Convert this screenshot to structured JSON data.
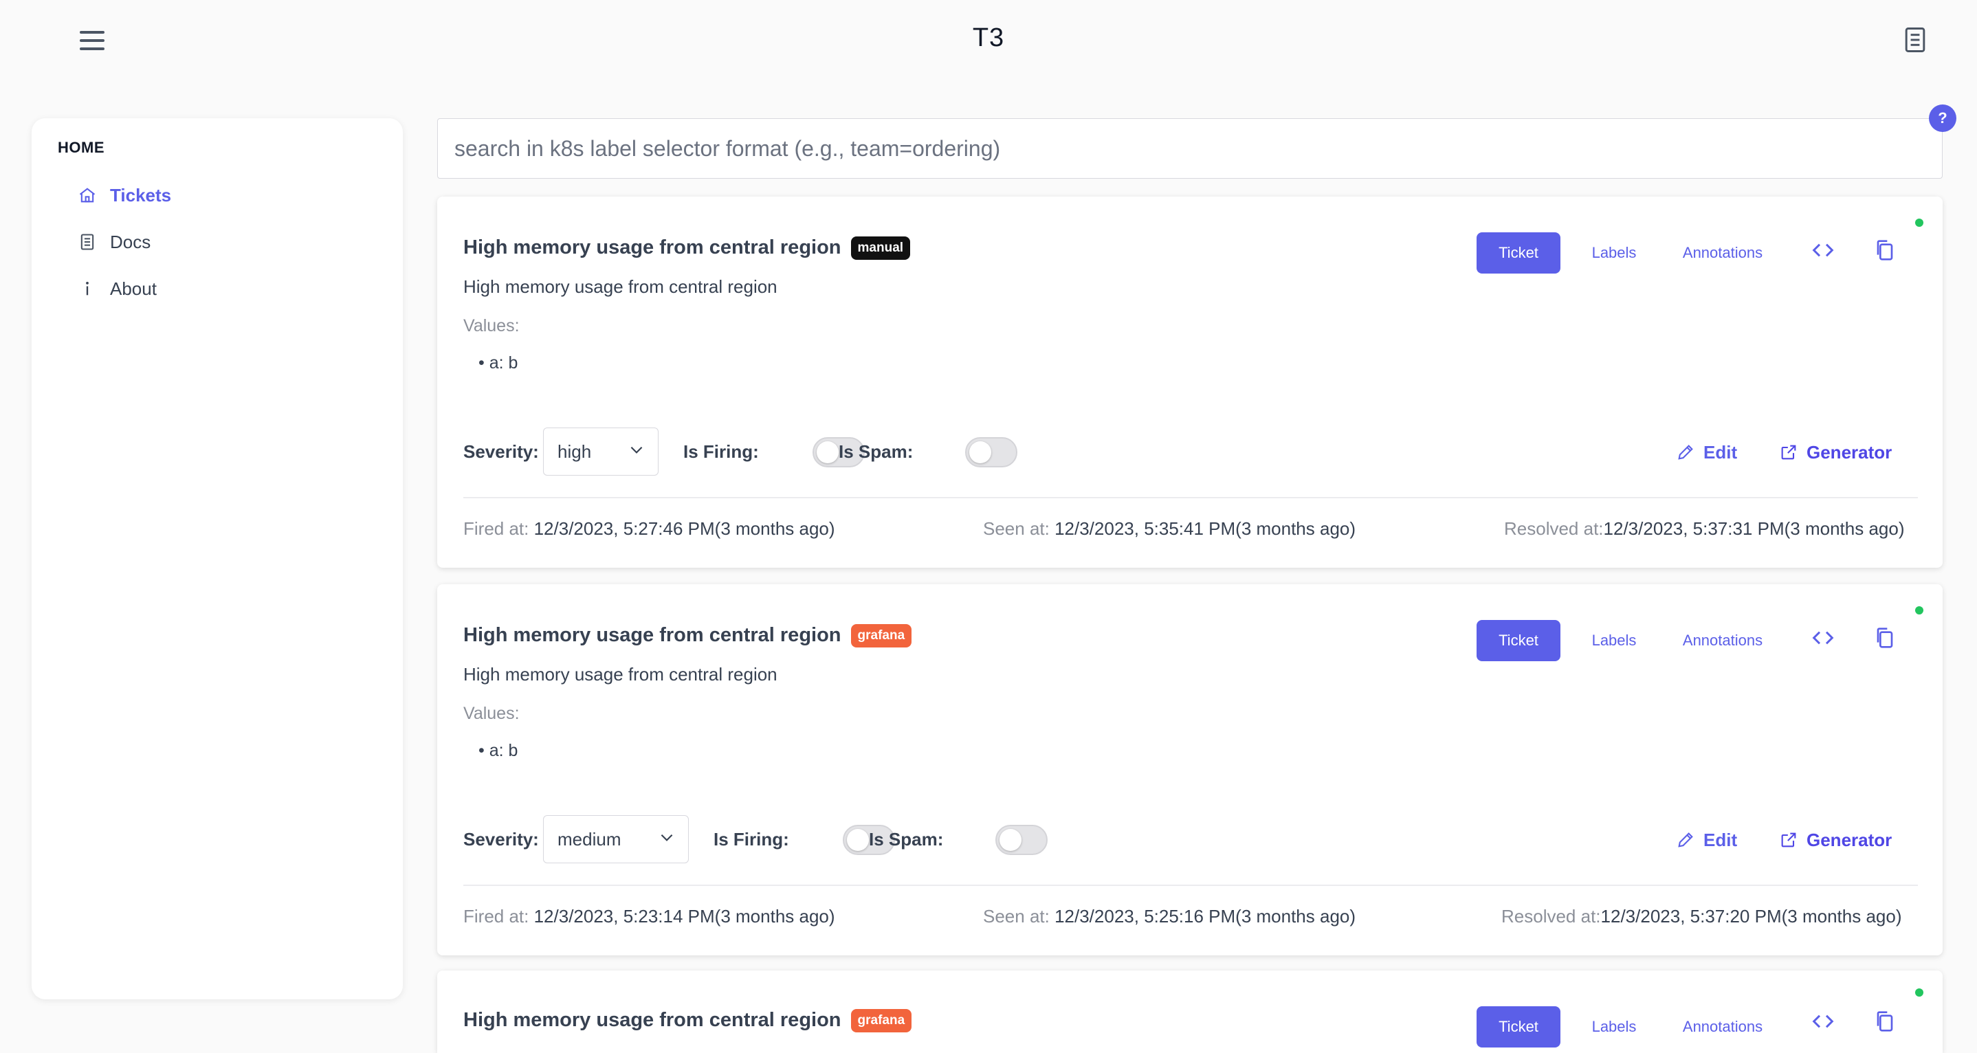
{
  "header": {
    "title": "T3",
    "menu_icon": "hamburger-menu-icon",
    "docs_icon": "document-icon"
  },
  "sidebar": {
    "heading": "HOME",
    "items": [
      {
        "label": "Tickets",
        "icon": "home-icon",
        "active": true
      },
      {
        "label": "Docs",
        "icon": "document-icon",
        "active": false
      },
      {
        "label": "About",
        "icon": "info-icon",
        "active": false
      }
    ]
  },
  "search": {
    "placeholder": "search in k8s label selector format (e.g., team=ordering)",
    "value": "",
    "help_label": "?"
  },
  "tab_labels": {
    "ticket": "Ticket",
    "labels": "Labels",
    "annotations": "Annotations"
  },
  "field_labels": {
    "values": "Values:",
    "severity": "Severity:",
    "is_firing": "Is Firing:",
    "is_spam": "Is Spam:",
    "edit": "Edit",
    "generator": "Generator",
    "fired_at": "Fired at: ",
    "seen_at": "Seen at: ",
    "resolved_at": "Resolved at:"
  },
  "tickets": [
    {
      "title": "High memory usage from central region",
      "source": "manual",
      "description": "High memory usage from central region",
      "values": [
        "a: b"
      ],
      "severity": "high",
      "is_firing": false,
      "is_spam": false,
      "fired_at": "12/3/2023, 5:27:46 PM(3 months ago)",
      "seen_at": "12/3/2023, 5:35:41 PM(3 months ago)",
      "resolved_at": "12/3/2023, 5:37:31 PM(3 months ago)"
    },
    {
      "title": "High memory usage from central region",
      "source": "grafana",
      "description": "High memory usage from central region",
      "values": [
        "a: b"
      ],
      "severity": "medium",
      "is_firing": false,
      "is_spam": false,
      "fired_at": "12/3/2023, 5:23:14 PM(3 months ago)",
      "seen_at": "12/3/2023, 5:25:16 PM(3 months ago)",
      "resolved_at": "12/3/2023, 5:37:20 PM(3 months ago)"
    },
    {
      "title": "High memory usage from central region",
      "source": "grafana"
    }
  ],
  "colors": {
    "accent": "#5b5fe8",
    "status_ok": "#22c55e",
    "badge_manual": "#111111",
    "badge_grafana": "#f2643c"
  }
}
